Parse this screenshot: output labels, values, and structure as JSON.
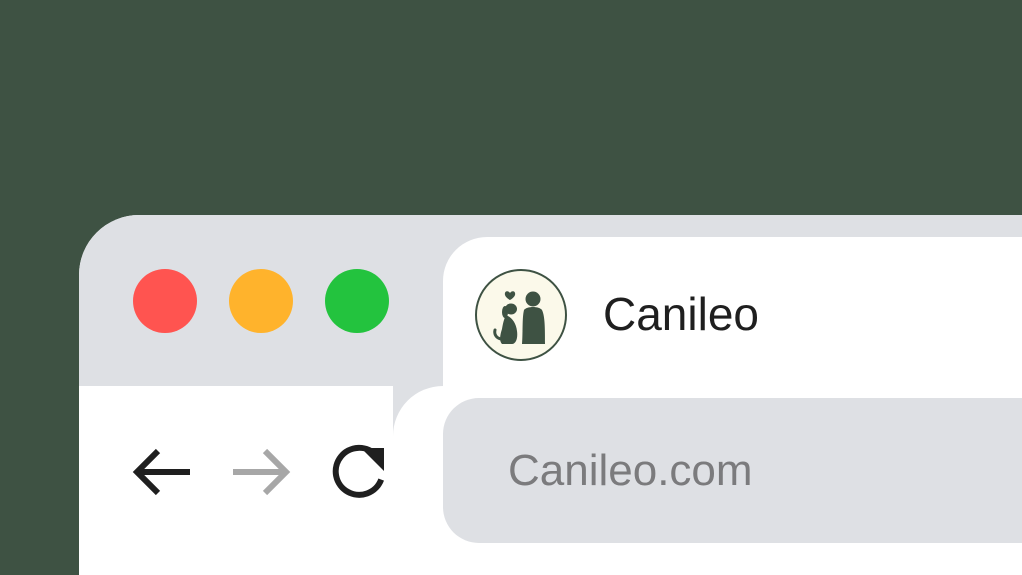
{
  "window": {
    "controls": [
      {
        "name": "close",
        "color": "#ff5450"
      },
      {
        "name": "minimize",
        "color": "#ffb32c"
      },
      {
        "name": "maximize",
        "color": "#23c33e"
      }
    ]
  },
  "tab": {
    "title": "Canileo",
    "favicon": "canileo-logo-icon"
  },
  "navigation": {
    "back_icon": "arrow-left-icon",
    "forward_icon": "arrow-right-icon",
    "reload_icon": "reload-icon",
    "forward_enabled": false
  },
  "address_bar": {
    "url": "Canileo.com"
  },
  "colors": {
    "background": "#3e5243",
    "tab_strip": "#dee0e4",
    "tab_active": "#ffffff",
    "address_bar": "#dee0e4",
    "address_text": "#7b7b7d",
    "icon_active": "#1f1f1f",
    "icon_disabled": "#a7a7a7"
  }
}
